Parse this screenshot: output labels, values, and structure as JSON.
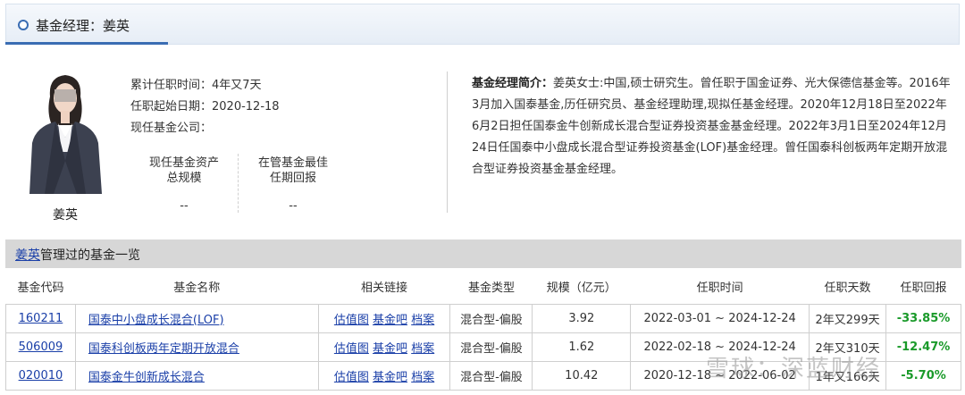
{
  "header": {
    "title": "基金经理：姜英"
  },
  "manager": {
    "name": "姜英",
    "tenure_label": "累计任职时间：",
    "tenure_value": "4年又7天",
    "start_label": "任职起始日期：",
    "start_value": "2020-12-18",
    "company_label": "现任基金公司：",
    "company_value": "",
    "stat1_label1": "现任基金资产",
    "stat1_label2": "总规模",
    "stat1_value": "--",
    "stat2_label1": "在管基金最佳",
    "stat2_label2": "任期回报",
    "stat2_value": "--",
    "bio_label": "基金经理简介：",
    "bio_text": "姜英女士:中国,硕士研究生。曾任职于国金证券、光大保德信基金等。2016年3月加入国泰基金,历任研究员、基金经理助理,现拟任基金经理。2020年12月18日至2022年6月2日担任国泰金牛创新成长混合型证券投资基金基金经理。2022年3月1日至2024年12月24日任国泰中小盘成长混合型证券投资基金(LOF)基金经理。曾任国泰科创板两年定期开放混合型证券投资基金基金经理。"
  },
  "fund_list": {
    "title_name": "姜英",
    "title_suffix": "管理过的基金一览",
    "columns": [
      "基金代码",
      "基金名称",
      "相关链接",
      "基金类型",
      "规模（亿元）",
      "任职时间",
      "任职天数",
      "任职回报"
    ],
    "rows": [
      {
        "code": "160211",
        "name": "国泰中小盘成长混合(LOF)",
        "link1": "估值图",
        "link2": "基金吧",
        "link3": "档案",
        "type": "混合型-偏股",
        "scale": "3.92",
        "period": "2022-03-01 ~ 2024-12-24",
        "days": "2年又299天",
        "return": "-33.85%"
      },
      {
        "code": "506009",
        "name": "国泰科创板两年定期开放混合",
        "link1": "估值图",
        "link2": "基金吧",
        "link3": "档案",
        "type": "混合型-偏股",
        "scale": "1.62",
        "period": "2022-02-18 ~ 2024-12-24",
        "days": "2年又310天",
        "return": "-12.47%"
      },
      {
        "code": "020010",
        "name": "国泰金牛创新成长混合",
        "link1": "估值图",
        "link2": "基金吧",
        "link3": "档案",
        "type": "混合型-偏股",
        "scale": "10.42",
        "period": "2020-12-18 ~ 2022-06-02",
        "days": "1年又166天",
        "return": "-5.70%"
      }
    ]
  },
  "watermark": "雪球：深蓝财经",
  "colors": {
    "link": "#1a3fa8",
    "negative_return": "#1a9a2a",
    "accent": "#3a6db3"
  }
}
